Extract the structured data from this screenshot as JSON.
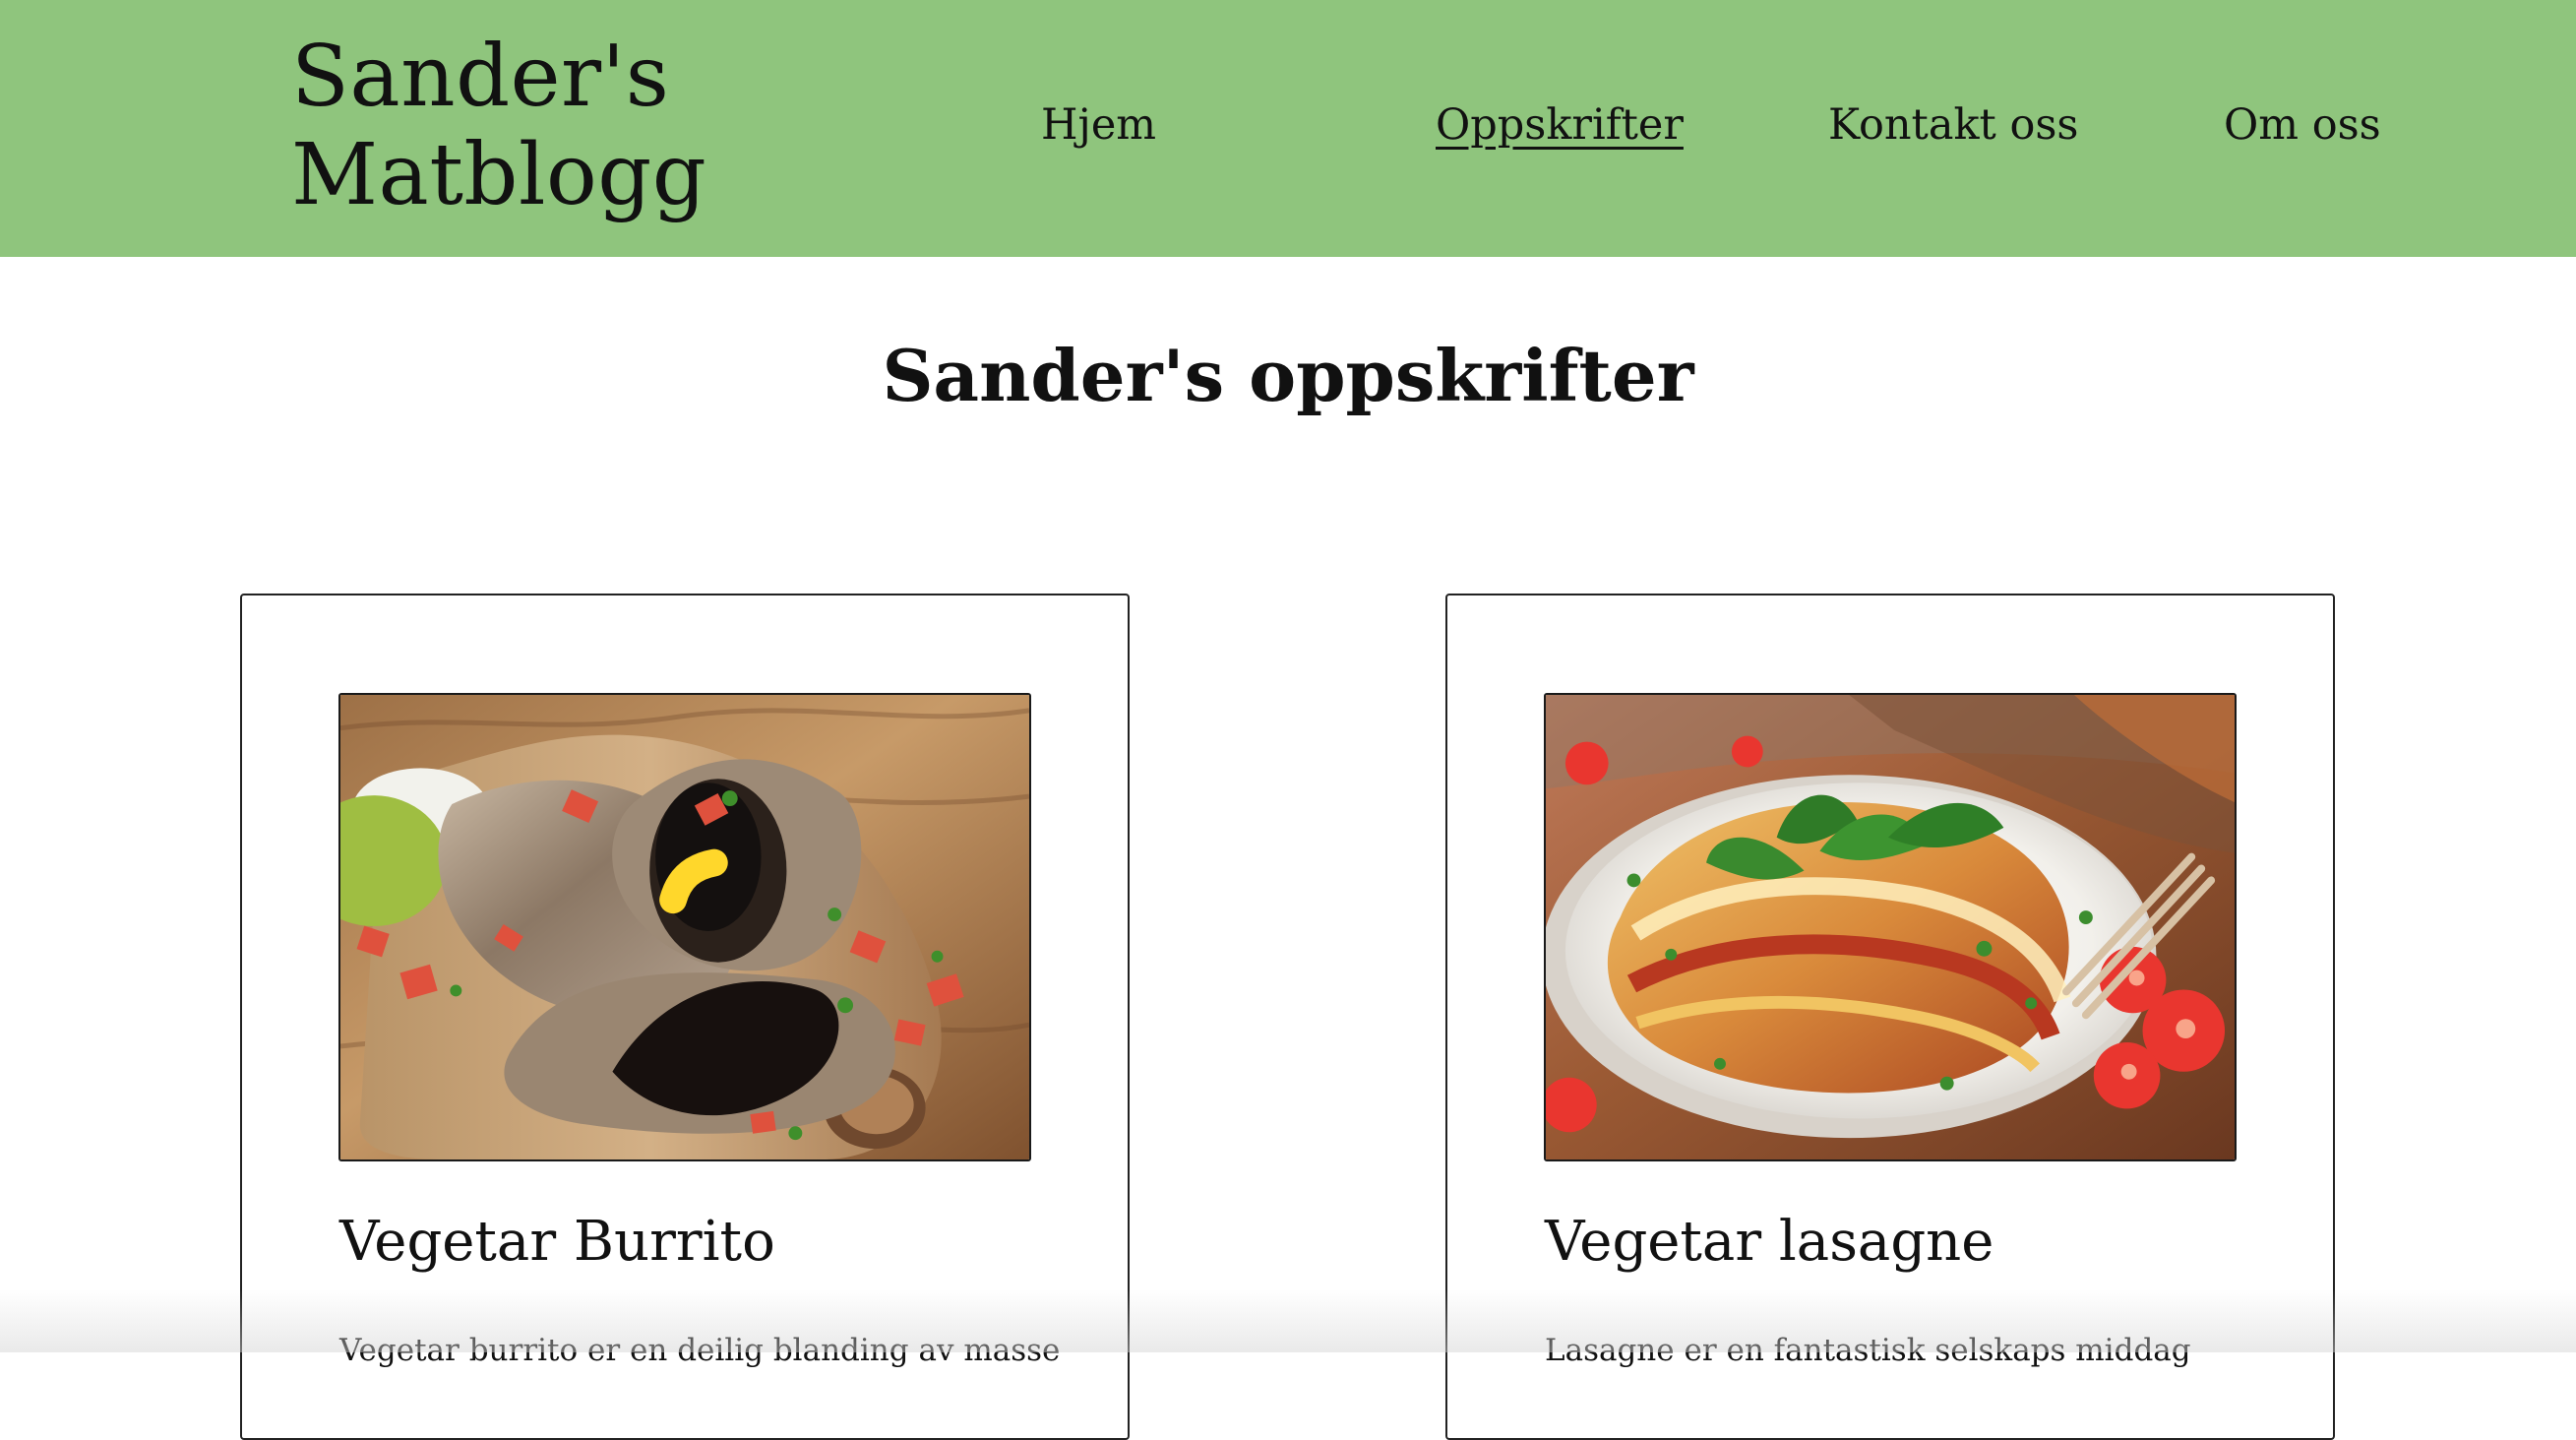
{
  "header": {
    "brand_line_1": "Sander's",
    "brand_line_2": "Matblogg",
    "nav": {
      "home": "Hjem",
      "recipes": "Oppskrifter",
      "contact": "Kontakt oss",
      "about": "Om oss"
    }
  },
  "main": {
    "title": "Sander's oppskrifter",
    "recipes": [
      {
        "image_icon": "vegetarian-burrito-photo",
        "title": "Vegetar Burrito",
        "description": "Vegetar burrito er en deilig blanding av masse"
      },
      {
        "image_icon": "vegetarian-lasagna-photo",
        "title": "Vegetar lasagne",
        "description": "Lasagne er en fantastisk selskaps middag"
      }
    ]
  },
  "colors": {
    "header_background": "#8fc57d",
    "text": "#111111",
    "card_border": "#222222",
    "background": "#ffffff"
  }
}
